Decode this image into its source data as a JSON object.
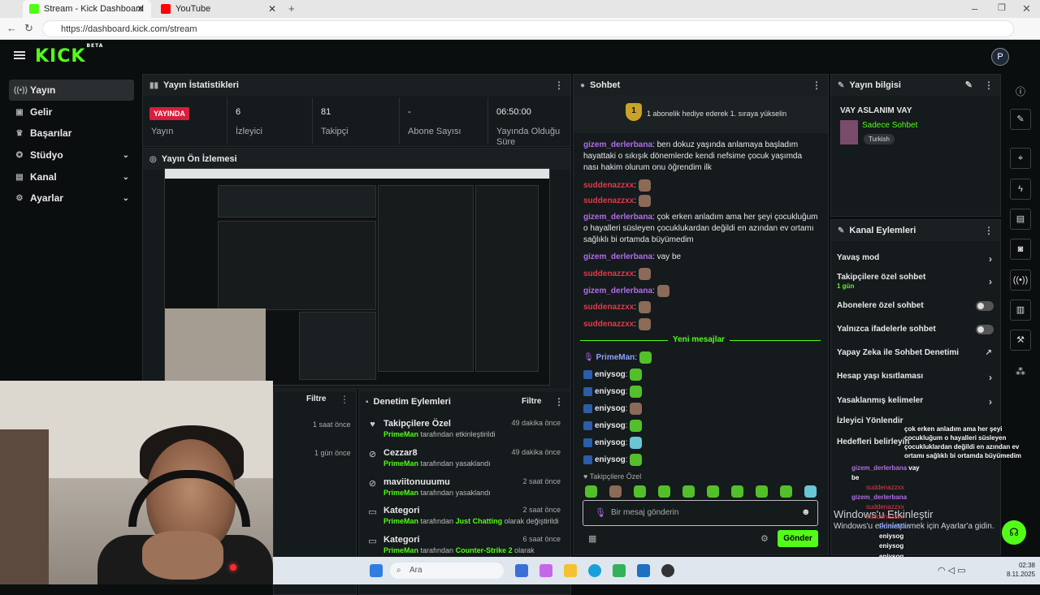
{
  "browser": {
    "tabs": [
      {
        "label": "Stream - Kick Dashboard",
        "active": true
      },
      {
        "label": "YouTube",
        "active": false
      }
    ],
    "url": "https://dashboard.kick.com/stream"
  },
  "app": {
    "logo": "KICK",
    "logo_tag": "BETA",
    "avatar": "P",
    "brand_color": "#53fc18"
  },
  "sidebar": {
    "items": [
      {
        "label": "Yayın",
        "icon": "broadcast-icon",
        "active": true
      },
      {
        "label": "Gelir",
        "icon": "wallet-icon"
      },
      {
        "label": "Başarılar",
        "icon": "trophy-icon"
      },
      {
        "label": "Stüdyo",
        "icon": "studio-icon",
        "expandable": true
      },
      {
        "label": "Kanal",
        "icon": "channel-icon",
        "expandable": true
      },
      {
        "label": "Ayarlar",
        "icon": "gear-icon",
        "expandable": true
      }
    ]
  },
  "stats": {
    "title": "Yayın İstatistikleri",
    "live_badge": "YAYINDA",
    "live_label": "Yayın",
    "viewers": {
      "value": "6",
      "label": "İzleyici"
    },
    "followers": {
      "value": "81",
      "label": "Takipçi"
    },
    "subs": {
      "value": "-",
      "label": "Abone Sayısı"
    },
    "uptime": {
      "value": "06:50:00",
      "label": "Yayında Olduğu Süre"
    }
  },
  "preview": {
    "title": "Yayın Ön İzlemesi"
  },
  "left_panel": {
    "filter": "Filtre",
    "times": [
      "1 saat önce",
      "1 gün önce"
    ]
  },
  "moderation": {
    "title": "Denetim Eylemleri",
    "filter": "Filtre",
    "items": [
      {
        "title": "Takipçilere Özel",
        "by": "PrimeMan",
        "action": "tarafından etkinleştirildi",
        "time": "49 dakika önce",
        "icon": "heart-icon"
      },
      {
        "title": "Cezzar8",
        "by": "PrimeMan",
        "action": "tarafından yasaklandı",
        "time": "49 dakika önce",
        "icon": "ban-icon"
      },
      {
        "title": "maviitonuuumu",
        "by": "PrimeMan",
        "action": "tarafından yasaklandı",
        "time": "2 saat önce",
        "icon": "ban-icon"
      },
      {
        "title": "Kategori",
        "by": "PrimeMan",
        "action_pre": "tarafından",
        "action_hl": "Just Chatting",
        "action_post": "olarak değiştirildi",
        "time": "2 saat önce",
        "icon": "category-icon"
      },
      {
        "title": "Kategori",
        "by": "PrimeMan",
        "action_pre": "tarafından",
        "action_hl": "Counter-Strike 2",
        "action_post": "olarak değiştirildi",
        "time": "6 saat önce",
        "icon": "category-icon"
      }
    ]
  },
  "chat": {
    "title": "Sohbet",
    "pinned": "1 abonelik hediye ederek 1. sıraya yükselin",
    "pinned_rank": "1",
    "messages": [
      {
        "user": "gizem_derlerbana",
        "color": "purple",
        "text": "ben dokuz yaşında anlamaya başladım hayattaki o sıkışık dönemlerde kendi nefsime çocuk yaşımda nası hakim olurum onu öğrendim ilk"
      },
      {
        "user": "suddenazzxx",
        "color": "red",
        "emote": "b"
      },
      {
        "user": "suddenazzxx",
        "color": "red",
        "emote": "b"
      },
      {
        "user": "gizem_derlerbana",
        "color": "purple",
        "text": "çok erken anladım ama her şeyi çocukluğum o hayalleri süsleyen çocuklukardan değildi en azından ev ortamı sağlıklı bi ortamda büyümedim"
      },
      {
        "user": "gizem_derlerbana",
        "color": "purple",
        "text": "vay be"
      },
      {
        "user": "suddenazzxx",
        "color": "red",
        "emote": "b"
      },
      {
        "user": "gizem_derlerbana",
        "color": "purple",
        "emote": "b"
      },
      {
        "user": "suddenazzxx",
        "color": "red",
        "emote": "b"
      },
      {
        "user": "suddenazzxx",
        "color": "red",
        "emote": "b"
      }
    ],
    "new_divider": "Yeni mesajlar",
    "new_messages": [
      {
        "user": "PrimeMan",
        "emote": "g"
      },
      {
        "user": "eniysog",
        "emote": "g"
      },
      {
        "user": "eniysog",
        "emote": "g"
      },
      {
        "user": "eniysog",
        "emote": "b"
      },
      {
        "user": "eniysog",
        "emote": "g"
      },
      {
        "user": "eniysog",
        "emote": "c"
      },
      {
        "user": "eniysog",
        "emote": "g"
      }
    ],
    "mode_label": "Takipçilere Özel",
    "input_placeholder": "Bir mesaj gönderin",
    "send": "Gönder"
  },
  "stream_info": {
    "title": "Yayın bilgisi",
    "stream_title": "VAY ASLANIM VAY",
    "category": "Sadece Sohbet",
    "tag": "Turkish"
  },
  "channel_actions": {
    "title": "Kanal Eylemleri",
    "items": [
      {
        "label": "Yavaş mod",
        "type": "chevron"
      },
      {
        "label": "Takipçilere özel sohbet",
        "sub": "1 gün",
        "type": "chevron"
      },
      {
        "label": "Abonelere özel sohbet",
        "type": "toggle"
      },
      {
        "label": "Yalnızca ifadelerle sohbet",
        "type": "toggle"
      },
      {
        "label": "Yapay Zeka ile Sohbet Denetimi",
        "type": "external"
      },
      {
        "label": "Hesap yaşı kısıtlaması",
        "type": "chevron"
      },
      {
        "label": "Yasaklanmış kelimeler",
        "type": "chevron"
      },
      {
        "label": "İzleyici Yönlendir",
        "type": "none"
      },
      {
        "label": "Hedefleri belirleyin",
        "type": "none"
      }
    ]
  },
  "overlay": {
    "windows_activate": "Windows'u Etkinleştir",
    "windows_activate_sub": "Windows'u etkinleştirmek için Ayarlar'a gidin.",
    "chat_text": "çok erken anladım ama her şeyi çocukluğum o hayalleri süsleyen çocukluklardan değildi en azından ev ortamı sağlıklı bi ortamda büyümedim",
    "chat_lines": [
      {
        "user": "gizem_derlerbana",
        "text": "vay be"
      },
      {
        "user": "suddenazzxx",
        "text": ""
      },
      {
        "user": "gizem_derlerbana",
        "text": ""
      },
      {
        "user": "suddenazzxx",
        "text": ""
      },
      {
        "user": "suddenazzxx",
        "text": ""
      },
      {
        "user": "PrimeMan",
        "text": ""
      },
      {
        "user": "eniysog",
        "text": ""
      },
      {
        "user": "eniysog",
        "text": ""
      },
      {
        "user": "eniysog",
        "text": ""
      },
      {
        "user": "eniysog",
        "text": ""
      },
      {
        "user": "eniysog",
        "text": ""
      },
      {
        "user": "eniysog",
        "text": ""
      }
    ]
  },
  "taskbar": {
    "search": "Ara",
    "time": "02:38",
    "date": "8.11.2025"
  }
}
